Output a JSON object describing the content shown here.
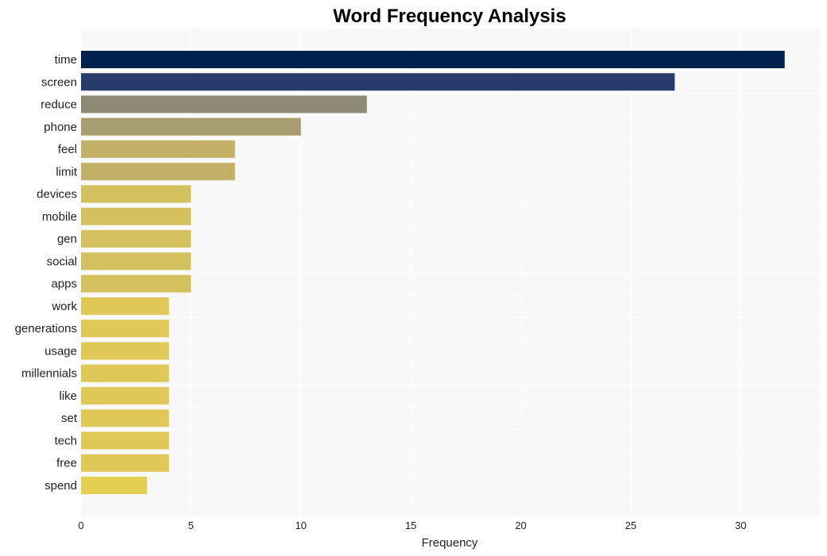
{
  "chart_data": {
    "type": "bar",
    "orientation": "horizontal",
    "title": "Word Frequency Analysis",
    "xlabel": "Frequency",
    "ylabel": "",
    "xlim": [
      0,
      33.6
    ],
    "xticks": [
      0,
      5,
      10,
      15,
      20,
      25,
      30
    ],
    "grid": true,
    "legend": "none",
    "categories": [
      "time",
      "screen",
      "reduce",
      "phone",
      "feel",
      "limit",
      "devices",
      "mobile",
      "gen",
      "social",
      "apps",
      "work",
      "generations",
      "usage",
      "millennials",
      "like",
      "set",
      "tech",
      "free",
      "spend"
    ],
    "values": [
      32,
      27,
      13,
      10,
      7,
      7,
      5,
      5,
      5,
      5,
      5,
      4,
      4,
      4,
      4,
      4,
      4,
      4,
      4,
      3
    ],
    "colors": [
      "#00204e",
      "#283c6c",
      "#8e8a76",
      "#a89d70",
      "#c3b16a",
      "#c3b16a",
      "#d3c160",
      "#d3c160",
      "#d3c160",
      "#d3c160",
      "#d3c160",
      "#dfc858",
      "#dfc858",
      "#dfc858",
      "#dfc858",
      "#dfc858",
      "#dfc858",
      "#dfc858",
      "#dfc858",
      "#e5cf52"
    ],
    "background": "#f8f8f8",
    "grid_color": "#ffffff"
  }
}
